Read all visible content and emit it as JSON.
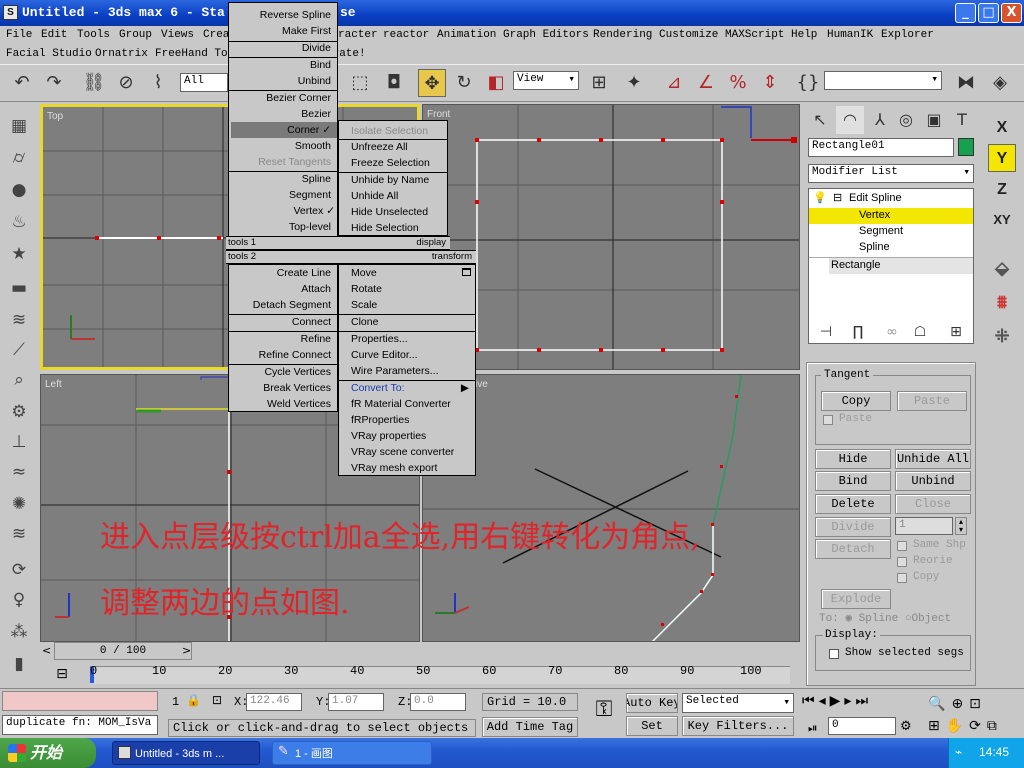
{
  "window": {
    "title": "Untitled - 3ds max 6 - Stand-alone License",
    "title_visible": "Untitled - 3ds max 6 - Sta",
    "title_tail": "se",
    "min": "_",
    "max": "□",
    "close": "X"
  },
  "menubar1": [
    "File",
    "Edit",
    "Tools",
    "Group",
    "Views",
    "Crea",
    "racter",
    "reactor",
    "Animation",
    "Graph Editors",
    "Rendering",
    "Customize",
    "MAXScript",
    "Help",
    "HumanIK",
    "Explorer"
  ],
  "menubar2": [
    "Facial Studio",
    "Ornatrix",
    "FreeHand Too",
    "trate!"
  ],
  "toolbar": {
    "filter": "All",
    "refcoord": "View"
  },
  "viewports": {
    "top": "Top",
    "front": "Front",
    "left": "Left",
    "perspective": "ive"
  },
  "quad_menu_left": {
    "items": [
      {
        "label": "Reverse Spline",
        "state": "normal"
      },
      {
        "label": "Make First",
        "state": "normal"
      },
      {
        "label": "Divide",
        "state": "normal"
      },
      {
        "label": "Bind",
        "state": "normal"
      },
      {
        "label": "Unbind",
        "state": "normal"
      },
      {
        "label": "Bezier Corner",
        "state": "normal"
      },
      {
        "label": "Bezier",
        "state": "normal"
      },
      {
        "label": "Corner",
        "state": "highlight",
        "check": "✓"
      },
      {
        "label": "Smooth",
        "state": "normal"
      },
      {
        "label": "Reset Tangents",
        "state": "disabled"
      },
      {
        "label": "Spline",
        "state": "normal"
      },
      {
        "label": "Segment",
        "state": "normal"
      },
      {
        "label": "Vertex",
        "state": "normal",
        "check": "✓"
      },
      {
        "label": "Top-level",
        "state": "normal"
      }
    ],
    "header1_left": "tools 1",
    "header1_right": "display",
    "header2_left": "tools 2",
    "header2_right": "transform",
    "items2": [
      {
        "label": "Create Line"
      },
      {
        "label": "Attach"
      },
      {
        "label": "Detach Segment"
      },
      {
        "label": "Connect"
      },
      {
        "label": "Refine"
      },
      {
        "label": "Refine Connect"
      },
      {
        "label": "Cycle Vertices"
      },
      {
        "label": "Break Vertices"
      },
      {
        "label": "Weld Vertices"
      }
    ]
  },
  "quad_menu_right": {
    "items": [
      {
        "label": "Isolate Selection",
        "state": "disabled"
      },
      {
        "label": "Unfreeze All",
        "state": "normal"
      },
      {
        "label": "Freeze Selection",
        "state": "normal"
      },
      {
        "label": "Unhide by Name",
        "state": "normal"
      },
      {
        "label": "Unhide All",
        "state": "normal"
      },
      {
        "label": "Hide Unselected",
        "state": "normal"
      },
      {
        "label": "Hide Selection",
        "state": "normal"
      }
    ],
    "items2": [
      {
        "label": "Move"
      },
      {
        "label": "Rotate"
      },
      {
        "label": "Scale"
      },
      {
        "label": "Clone"
      },
      {
        "label": "Properties..."
      },
      {
        "label": "Curve Editor..."
      },
      {
        "label": "Wire Parameters..."
      },
      {
        "label": "Convert To:",
        "arrow": "▶"
      },
      {
        "label": "fR Material Converter"
      },
      {
        "label": "fRProperties"
      },
      {
        "label": "VRay properties"
      },
      {
        "label": "VRay scene converter"
      },
      {
        "label": "VRay mesh export"
      }
    ]
  },
  "command_panel": {
    "object_name": "Rectangle01",
    "modifier_list": "Modifier List",
    "stack": [
      {
        "label": "Edit Spline",
        "selected": false
      },
      {
        "label": "Vertex",
        "selected": true
      },
      {
        "label": "Segment",
        "selected": false
      },
      {
        "label": "Spline",
        "selected": false
      },
      {
        "label": "Rectangle",
        "selected": false
      }
    ],
    "tangent_label": "Tangent",
    "copy": "Copy",
    "paste": "Paste",
    "paste_check": "Paste",
    "hide": "Hide",
    "unhide_all": "Unhide All",
    "bind": "Bind",
    "unbind": "Unbind",
    "delete": "Delete",
    "close": "Close",
    "divide": "Divide",
    "divide_value": "1",
    "detach": "Detach",
    "same_shp": "Same Shp",
    "reorie": "Reorie",
    "copy_check": "Copy",
    "explode": "Explode",
    "to_label": "To:",
    "spline_opt": "Spline",
    "object_opt": "Object",
    "display_label": "Display:",
    "show_selected": "Show selected segs"
  },
  "axes": [
    "X",
    "Y",
    "Z",
    "XY"
  ],
  "timeline": {
    "counter": "0 / 100",
    "ticks": [
      "0",
      "10",
      "20",
      "30",
      "40",
      "50",
      "60",
      "70",
      "80",
      "90",
      "100"
    ]
  },
  "status": {
    "selection_count": "1",
    "x_label": "X:",
    "x": "122.46",
    "y_label": "Y:",
    "y": "1.07",
    "z_label": "Z:",
    "z": "0.0",
    "grid": "Grid = 10.0",
    "prompt": "Click or click-and-drag to select objects",
    "add_time_tag": "Add Time Tag",
    "script_line": "duplicate fn: MOM_IsVa",
    "auto_key": "Auto Key",
    "set_key": "Set Key",
    "selected_dropdown": "Selected",
    "key_filters": "Key Filters...",
    "frame": "0"
  },
  "caption": {
    "line1": "进入点层级按ctrl加a全选,用右键转化为角点,",
    "line2": "调整两边的点如图."
  },
  "taskbar": {
    "start": "开始",
    "task1": "Untitled - 3ds m ...",
    "task2": "1 - 画图",
    "clock": "14:45"
  }
}
